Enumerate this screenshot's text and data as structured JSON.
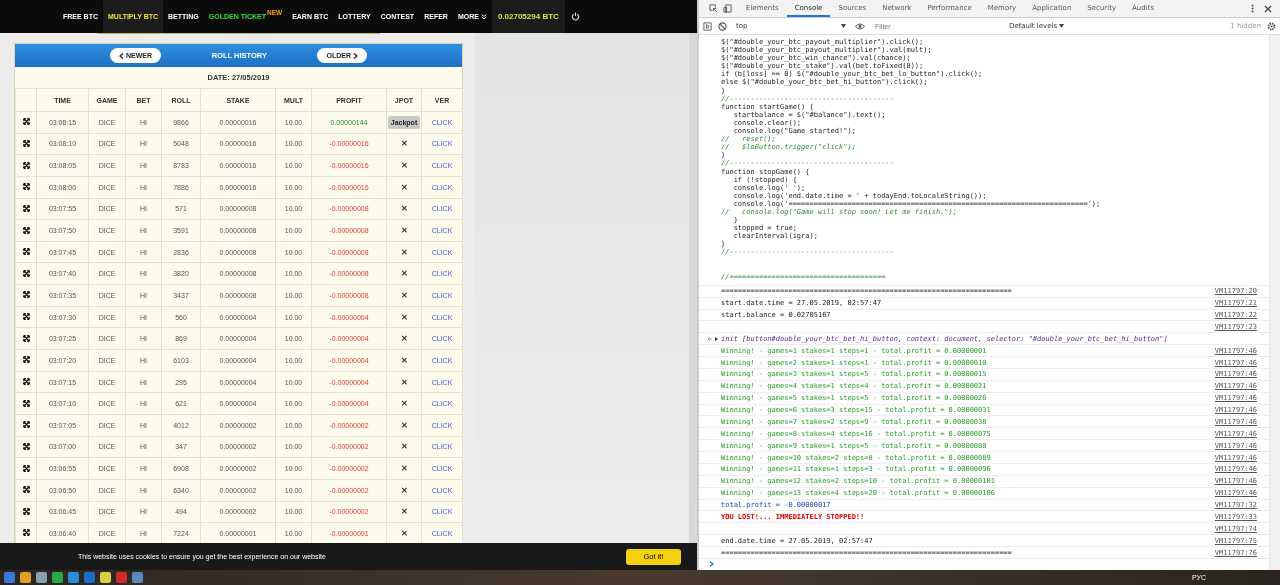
{
  "browser_nav": {
    "items": [
      {
        "label": "FREE BTC",
        "kind": "link",
        "selected": false
      },
      {
        "label": "MULTIPLY BTC",
        "kind": "link",
        "selected": true
      },
      {
        "label": "BETTING",
        "kind": "link",
        "selected": false
      },
      {
        "label": "GOLDEN TICKET",
        "kind": "promo",
        "badge": "NEW",
        "selected": false
      },
      {
        "label": "EARN BTC",
        "kind": "link",
        "selected": false
      },
      {
        "label": "LOTTERY",
        "kind": "link",
        "selected": false
      },
      {
        "label": "CONTEST",
        "kind": "link",
        "selected": false
      },
      {
        "label": "REFER",
        "kind": "link",
        "selected": false
      },
      {
        "label": "MORE",
        "kind": "menu",
        "selected": false
      }
    ],
    "balance": "0.02705294 BTC"
  },
  "roll_history": {
    "title": "ROLL HISTORY",
    "newer_button": "NEWER",
    "older_button": "OLDER",
    "date": "DATE: 27/05/2019",
    "columns": [
      "TIME",
      "GAME",
      "BET",
      "ROLL",
      "STAKE",
      "MULT",
      "PROFIT",
      "JPOT",
      "VER"
    ],
    "rows": [
      {
        "time": "03:08:15",
        "game": "DICE",
        "bet": "HI",
        "roll": "9866",
        "stake": "0.00000016",
        "mult": "10.00",
        "profit": "0.00000144",
        "kind": "win",
        "jpot": {
          "kind": "tooltip",
          "text": "Jackpot"
        },
        "ver": "CLICK"
      },
      {
        "time": "03:08:10",
        "game": "DICE",
        "bet": "HI",
        "roll": "5048",
        "stake": "0.00000016",
        "mult": "10.00",
        "profit": "-0.00000016",
        "kind": "loss",
        "jpot": {
          "kind": "mark",
          "text": "✕"
        },
        "ver": "CLICK"
      },
      {
        "time": "03:08:05",
        "game": "DICE",
        "bet": "HI",
        "roll": "8783",
        "stake": "0.00000016",
        "mult": "10.00",
        "profit": "-0.00000016",
        "kind": "loss",
        "jpot": {
          "kind": "mark",
          "text": "✕"
        },
        "ver": "CLICK"
      },
      {
        "time": "03:08:00",
        "game": "DICE",
        "bet": "HI",
        "roll": "7886",
        "stake": "0.00000016",
        "mult": "10.00",
        "profit": "-0.00000016",
        "kind": "loss",
        "jpot": {
          "kind": "mark",
          "text": "✕"
        },
        "ver": "CLICK"
      },
      {
        "time": "03:07:55",
        "game": "DICE",
        "bet": "HI",
        "roll": "571",
        "stake": "0.00000008",
        "mult": "10.00",
        "profit": "-0.00000008",
        "kind": "loss",
        "jpot": {
          "kind": "mark",
          "text": "✕"
        },
        "ver": "CLICK"
      },
      {
        "time": "03:07:50",
        "game": "DICE",
        "bet": "HI",
        "roll": "3591",
        "stake": "0.00000008",
        "mult": "10.00",
        "profit": "-0.00000008",
        "kind": "loss",
        "jpot": {
          "kind": "mark",
          "text": "✕"
        },
        "ver": "CLICK"
      },
      {
        "time": "03:07:45",
        "game": "DICE",
        "bet": "HI",
        "roll": "2836",
        "stake": "0.00000008",
        "mult": "10.00",
        "profit": "-0.00000008",
        "kind": "loss",
        "jpot": {
          "kind": "mark",
          "text": "✕"
        },
        "ver": "CLICK"
      },
      {
        "time": "03:07:40",
        "game": "DICE",
        "bet": "HI",
        "roll": "3820",
        "stake": "0.00000008",
        "mult": "10.00",
        "profit": "-0.00000008",
        "kind": "loss",
        "jpot": {
          "kind": "mark",
          "text": "✕"
        },
        "ver": "CLICK"
      },
      {
        "time": "03:07:35",
        "game": "DICE",
        "bet": "HI",
        "roll": "3437",
        "stake": "0.00000008",
        "mult": "10.00",
        "profit": "-0.00000008",
        "kind": "loss",
        "jpot": {
          "kind": "mark",
          "text": "✕"
        },
        "ver": "CLICK"
      },
      {
        "time": "03:07:30",
        "game": "DICE",
        "bet": "HI",
        "roll": "560",
        "stake": "0.00000004",
        "mult": "10.00",
        "profit": "-0.00000004",
        "kind": "loss",
        "jpot": {
          "kind": "mark",
          "text": "✕"
        },
        "ver": "CLICK"
      },
      {
        "time": "03:07:25",
        "game": "DICE",
        "bet": "HI",
        "roll": "869",
        "stake": "0.00000004",
        "mult": "10.00",
        "profit": "-0.00000004",
        "kind": "loss",
        "jpot": {
          "kind": "mark",
          "text": "✕"
        },
        "ver": "CLICK"
      },
      {
        "time": "03:07:20",
        "game": "DICE",
        "bet": "HI",
        "roll": "6103",
        "stake": "0.00000004",
        "mult": "10.00",
        "profit": "-0.00000004",
        "kind": "loss",
        "jpot": {
          "kind": "mark",
          "text": "✕"
        },
        "ver": "CLICK"
      },
      {
        "time": "03:07:15",
        "game": "DICE",
        "bet": "HI",
        "roll": "295",
        "stake": "0.00000004",
        "mult": "10.00",
        "profit": "-0.00000004",
        "kind": "loss",
        "jpot": {
          "kind": "mark",
          "text": "✕"
        },
        "ver": "CLICK"
      },
      {
        "time": "03:07:10",
        "game": "DICE",
        "bet": "HI",
        "roll": "621",
        "stake": "0.00000004",
        "mult": "10.00",
        "profit": "-0.00000004",
        "kind": "loss",
        "jpot": {
          "kind": "mark",
          "text": "✕"
        },
        "ver": "CLICK"
      },
      {
        "time": "03:07:05",
        "game": "DICE",
        "bet": "HI",
        "roll": "4012",
        "stake": "0.00000002",
        "mult": "10.00",
        "profit": "-0.00000002",
        "kind": "loss",
        "jpot": {
          "kind": "mark",
          "text": "✕"
        },
        "ver": "CLICK"
      },
      {
        "time": "03:07:00",
        "game": "DICE",
        "bet": "HI",
        "roll": "347",
        "stake": "0.00000002",
        "mult": "10.00",
        "profit": "-0.00000002",
        "kind": "loss",
        "jpot": {
          "kind": "mark",
          "text": "✕"
        },
        "ver": "CLICK"
      },
      {
        "time": "03:06:55",
        "game": "DICE",
        "bet": "HI",
        "roll": "6908",
        "stake": "0.00000002",
        "mult": "10.00",
        "profit": "-0.00000002",
        "kind": "loss",
        "jpot": {
          "kind": "mark",
          "text": "✕"
        },
        "ver": "CLICK"
      },
      {
        "time": "03:06:50",
        "game": "DICE",
        "bet": "HI",
        "roll": "6340",
        "stake": "0.00000002",
        "mult": "10.00",
        "profit": "-0.00000002",
        "kind": "loss",
        "jpot": {
          "kind": "mark",
          "text": "✕"
        },
        "ver": "CLICK"
      },
      {
        "time": "03:06:45",
        "game": "DICE",
        "bet": "HI",
        "roll": "494",
        "stake": "0.00000002",
        "mult": "10.00",
        "profit": "-0.00000002",
        "kind": "loss",
        "jpot": {
          "kind": "mark",
          "text": "✕"
        },
        "ver": "CLICK"
      },
      {
        "time": "03:06:40",
        "game": "DICE",
        "bet": "HI",
        "roll": "7224",
        "stake": "0.00000001",
        "mult": "10.00",
        "profit": "-0.00000001",
        "kind": "loss",
        "jpot": {
          "kind": "mark",
          "text": "✕"
        },
        "ver": "CLICK"
      }
    ]
  },
  "cookie_banner": {
    "text": "This website uses cookies to ensure you get the best experience on our website",
    "button": "Got it!"
  },
  "devtools": {
    "tabs": [
      {
        "label": "Elements",
        "selected": false
      },
      {
        "label": "Console",
        "selected": true
      },
      {
        "label": "Sources",
        "selected": false
      },
      {
        "label": "Network",
        "selected": false
      },
      {
        "label": "Performance",
        "selected": false
      },
      {
        "label": "Memory",
        "selected": false
      },
      {
        "label": "Application",
        "selected": false
      },
      {
        "label": "Security",
        "selected": false
      },
      {
        "label": "Audits",
        "selected": false
      }
    ],
    "context": "top",
    "filter_placeholder": "Filter",
    "levels": "Default levels",
    "hidden_count": "1 hidden",
    "code_lines": [
      {
        "kind": "code",
        "text": "$(\"#double_your_btc_payout_multiplier\").click();"
      },
      {
        "kind": "code",
        "text": "$(\"#double_your_btc_payout_multiplier\").val(mult);"
      },
      {
        "kind": "code",
        "text": "$(\"#double_your_btc_win_chance\").val(chance);"
      },
      {
        "kind": "code",
        "text": "$(\"#double_your_btc_stake\").val(bet.toFixed(8));"
      },
      {
        "kind": "code",
        "text": "if (b[loss] == 0) $(\"#double_your_btc_bet_lo_button\").click();"
      },
      {
        "kind": "code",
        "text": "else $(\"#double_your_btc_bet_hi_button\").click();"
      },
      {
        "kind": "code",
        "text": "}"
      },
      {
        "kind": "comment",
        "text": "//---------------------------------------"
      },
      {
        "kind": "code",
        "text": "function startGame() {"
      },
      {
        "kind": "code",
        "text": "   startbalance = $(\"#balance\").text();"
      },
      {
        "kind": "code",
        "text": "   console.clear();"
      },
      {
        "kind": "code",
        "text": "   console.log(\"Game started!\");"
      },
      {
        "kind": "comment",
        "text": "//   reset();"
      },
      {
        "kind": "comment",
        "text": "//   $loButton.trigger(\"click\");"
      },
      {
        "kind": "code",
        "text": "}"
      },
      {
        "kind": "comment",
        "text": "//---------------------------------------"
      },
      {
        "kind": "code",
        "text": "function stopGame() {"
      },
      {
        "kind": "code",
        "text": "   if (!stopped) {"
      },
      {
        "kind": "code",
        "text": "   console.log(' ');"
      },
      {
        "kind": "code",
        "text": "   console.log('end.date.time = ' + todayEnd.toLocaleString());"
      },
      {
        "kind": "code",
        "text": "   console.log('=======================================================================');"
      },
      {
        "kind": "comment",
        "text": "//   console.log(\"Game will stop soon! Let me finish.\");"
      },
      {
        "kind": "code",
        "text": "   }"
      },
      {
        "kind": "code",
        "text": "   stopped = true;"
      },
      {
        "kind": "code",
        "text": "   clearInterval(igra);"
      },
      {
        "kind": "code",
        "text": "}"
      },
      {
        "kind": "comment",
        "text": "//---------------------------------------"
      },
      {
        "kind": "blank"
      },
      {
        "kind": "blank"
      },
      {
        "kind": "comment",
        "text": "//====================================="
      }
    ],
    "messages": [
      {
        "kind": "log",
        "text": "=====================================================================",
        "source": "VM11797:20"
      },
      {
        "kind": "log",
        "text": "start.date.time = 27.05.2019, 02:57:47",
        "source": "VM11797:21"
      },
      {
        "kind": "log",
        "text": "start.balance = 0.02705167",
        "source": "VM11797:22"
      },
      {
        "kind": "log",
        "source": "VM11797:23"
      },
      {
        "kind": "result",
        "text": "init [button#double_your_btc_bet_hi_button, context: document, selector: \"#double_your_btc_bet_hi_button\"]"
      },
      {
        "kind": "success",
        "text": "Winning! - games=1 stakes=1 steps=1 - total.profit = 0.00000001",
        "source": "VM11797:46"
      },
      {
        "kind": "success",
        "text": "Winning! - games=2 stakes=1 steps=1 - total.profit = 0.00000010",
        "source": "VM11797:46"
      },
      {
        "kind": "success",
        "text": "Winning! - games=3 stakes=1 steps=5 - total.profit = 0.00000015",
        "source": "VM11797:46"
      },
      {
        "kind": "success",
        "text": "Winning! - games=4 stakes=1 steps=4 - total.profit = 0.00000021",
        "source": "VM11797:46"
      },
      {
        "kind": "success",
        "text": "Winning! - games=5 stakes=1 steps=5 - total.profit = 0.00000026",
        "source": "VM11797:46"
      },
      {
        "kind": "success",
        "text": "Winning! - games=6 stakes=3 steps=15 - total.profit = 0.00000031",
        "source": "VM11797:46"
      },
      {
        "kind": "success",
        "text": "Winning! - games=7 stakes=2 steps=9 - total.profit = 0.00000038",
        "source": "VM11797:46"
      },
      {
        "kind": "success",
        "text": "Winning! - games=8 stakes=4 steps=16 - total.profit = 0.00000075",
        "source": "VM11797:46"
      },
      {
        "kind": "success",
        "text": "Winning! - games=9 stakes=1 steps=5 - total.profit = 0.00000080",
        "source": "VM11797:46"
      },
      {
        "kind": "success",
        "text": "Winning! - games=10 stakes=2 steps=8 - total.profit = 0.00000089",
        "source": "VM11797:46"
      },
      {
        "kind": "success",
        "text": "Winning! - games=11 stakes=1 steps=3 - total.profit = 0.00000096",
        "source": "VM11797:46"
      },
      {
        "kind": "success",
        "text": "Winning! - games=12 stakes=2 steps=10 - total.profit = 0.00000101",
        "source": "VM11797:46"
      },
      {
        "kind": "success",
        "text": "Winning! - games=13 stakes=4 steps=20 - total.profit = 0.00000106",
        "source": "VM11797:46"
      },
      {
        "kind": "info",
        "text": "total.profit = -0.00000017",
        "source": "VM11797:32"
      },
      {
        "kind": "error",
        "text": "YOU LOST!... IMMEDIATELY STOPPED!!",
        "source": "VM11797:33"
      },
      {
        "kind": "log",
        "source": "VM11797:74"
      },
      {
        "kind": "log",
        "text": "end.date.time = 27.05.2019, 02:57:47",
        "source": "VM11797:75"
      },
      {
        "kind": "log",
        "text": "=====================================================================",
        "source": "VM11797:76"
      }
    ]
  },
  "taskbar": {
    "language": "РУС"
  }
}
